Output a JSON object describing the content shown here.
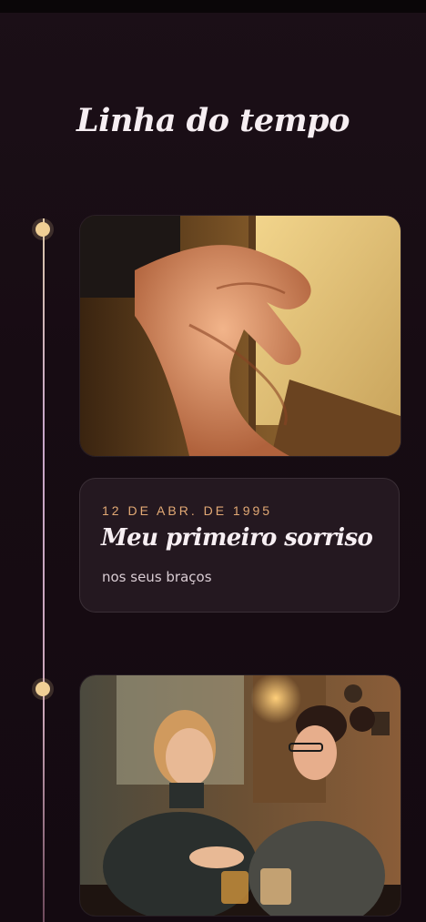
{
  "timeline": {
    "title": "Linha do tempo",
    "entries": [
      {
        "date": "12 DE ABR. DE 1995",
        "title": "Meu primeiro sorriso",
        "subtitle": "nos seus braços"
      }
    ]
  },
  "colors": {
    "background": "#170c13",
    "accent_gold": "#f0cf95",
    "date_orange": "#e2a975",
    "card_bg": "#241820",
    "text_primary": "#f7eff3"
  }
}
